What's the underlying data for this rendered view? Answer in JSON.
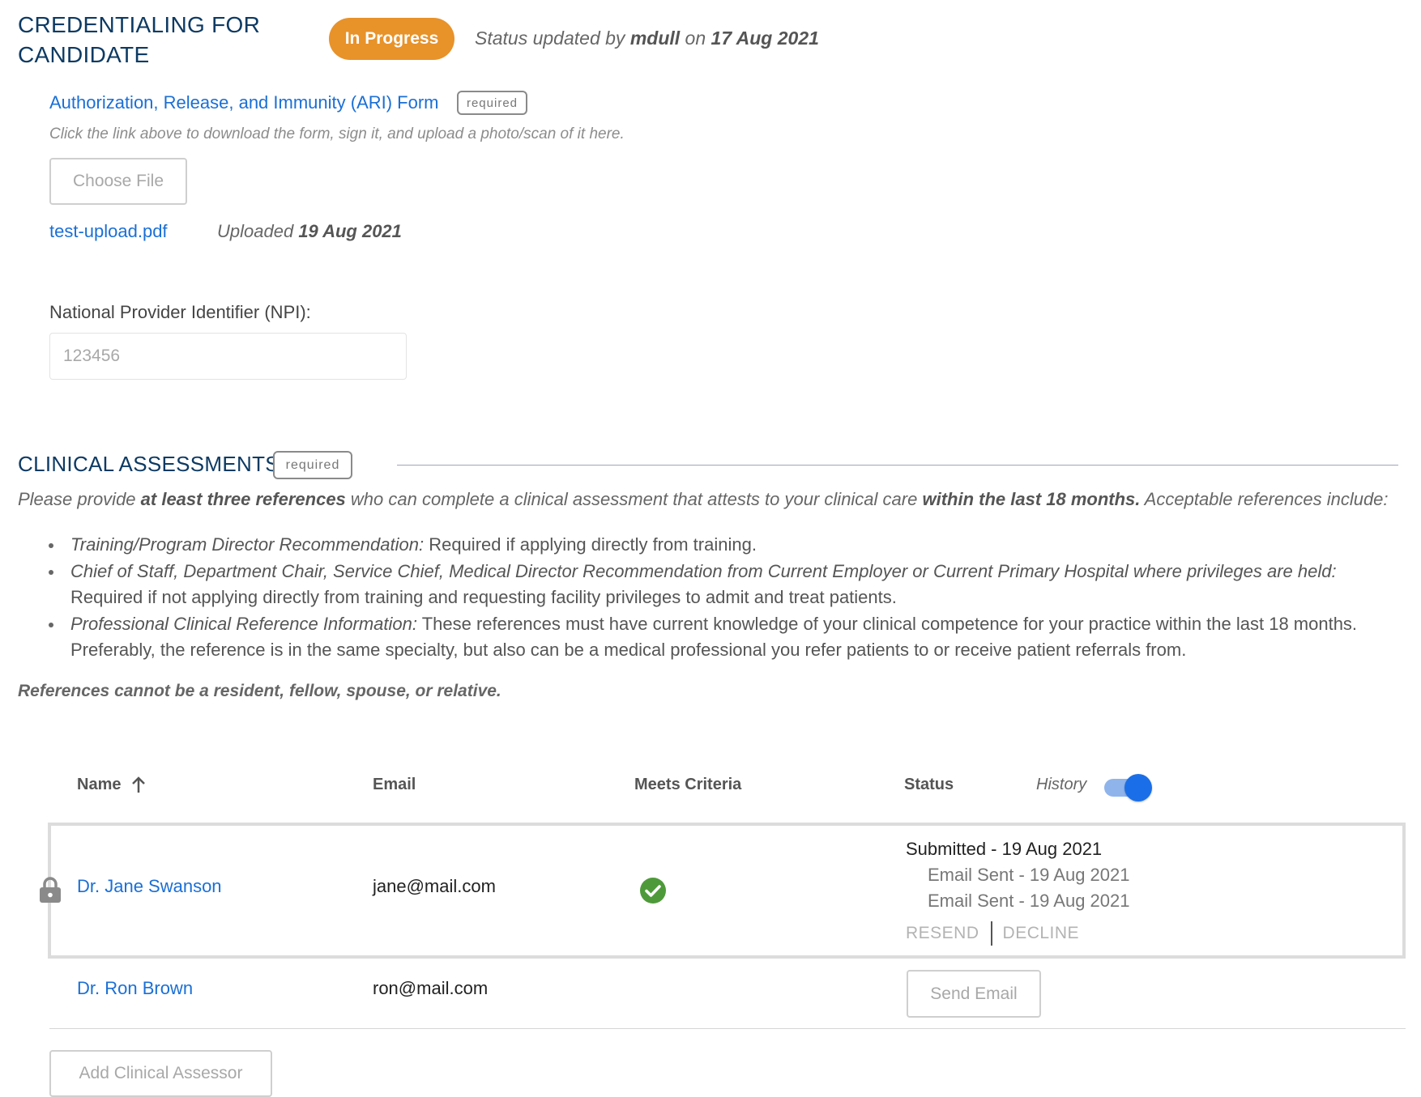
{
  "header": {
    "title": "CREDENTIALING FOR CANDIDATE",
    "status_badge": "In Progress",
    "status_prefix": "Status updated by",
    "status_user": "mdull",
    "status_on": "on",
    "status_date": "17 Aug 2021",
    "status_color": "#e8922a"
  },
  "ari_form": {
    "link_label": "Authorization, Release, and Immunity (ARI) Form",
    "required_label": "required",
    "hint": "Click the link above to download the form, sign it, and upload a photo/scan of it here.",
    "choose_file_label": "Choose File",
    "uploaded_file": "test-upload.pdf",
    "uploaded_prefix": "Uploaded",
    "uploaded_date": "19 Aug 2021"
  },
  "npi": {
    "label": "National Provider Identifier (NPI):",
    "placeholder": "123456",
    "value": ""
  },
  "clinical_assessments": {
    "title": "CLINICAL ASSESSMENTS",
    "required_label": "required",
    "intro_1": "Please provide ",
    "intro_bold_1": "at least three references",
    "intro_2": " who can complete a clinical assessment that attests to your clinical care ",
    "intro_bold_2": "within the last 18 months.",
    "intro_3": " Acceptable references include:",
    "references": [
      {
        "type": "Training/Program Director Recommendation:",
        "description": " Required if applying directly from training."
      },
      {
        "type": "Chief of Staff, Department Chair, Service Chief, Medical Director Recommendation from Current Employer or Current Primary Hospital where privileges are held:",
        "description": " Required if not applying directly from training and requesting facility privileges to admit and treat patients."
      },
      {
        "type": "Professional Clinical Reference Information:",
        "description": " These references must have current knowledge of your clinical competence for your practice within the last 18 months. Preferably, the reference is in the same specialty, but also can be a medical professional you refer patients to or receive patient referrals from."
      }
    ],
    "warning": "References cannot be a resident, fellow, spouse, or relative."
  },
  "table": {
    "columns": {
      "name": "Name",
      "email": "Email",
      "criteria": "Meets Criteria",
      "status": "Status"
    },
    "sort_icon": "arrow-up-icon",
    "history_label": "History",
    "history_on": true,
    "rows": [
      {
        "name": "Dr. Jane Swanson",
        "email": "jane@mail.com",
        "locked": true,
        "meets_criteria": true,
        "status_main": "Submitted - 19 Aug 2021",
        "history": [
          "Email Sent - 19 Aug 2021",
          "Email Sent - 19 Aug 2021"
        ],
        "resend_label": "RESEND",
        "decline_label": "DECLINE"
      },
      {
        "name": "Dr. Ron Brown",
        "email": "ron@mail.com",
        "locked": false,
        "meets_criteria": null,
        "send_email_label": "Send Email"
      }
    ],
    "add_assessor_label": "Add Clinical Assessor"
  }
}
